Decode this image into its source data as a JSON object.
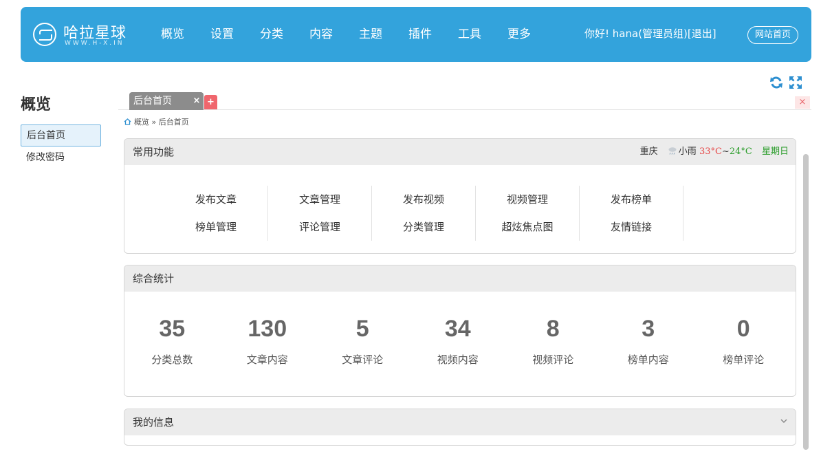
{
  "header": {
    "logo_title": "哈拉星球",
    "logo_sub": "WWW.H-X.IN",
    "nav": [
      "概览",
      "设置",
      "分类",
      "内容",
      "主题",
      "插件",
      "工具",
      "更多"
    ],
    "greeting": "你好!",
    "username": "hana",
    "role": "(管理员组)",
    "logout": "[退出]",
    "site_home": "网站首页",
    "bg_color": "#33a3dc"
  },
  "sidebar": {
    "title": "概览",
    "items": [
      {
        "label": "后台首页",
        "active": true
      },
      {
        "label": "修改密码",
        "active": false
      }
    ]
  },
  "tools": {
    "refresh_icon": "refresh-icon",
    "fullscreen_icon": "fullscreen-icon"
  },
  "tabs": {
    "active_label": "后台首页",
    "close_glyph": "×",
    "add_glyph": "+",
    "close_all_glyph": "×"
  },
  "breadcrumb": {
    "home": "概览",
    "separator": "»",
    "current": "后台首页"
  },
  "common": {
    "title": "常用功能",
    "weather": {
      "city": "重庆",
      "condition": "小雨",
      "high": "33°C",
      "tilde": "~",
      "low": "24°C",
      "day": "星期日"
    },
    "columns": [
      [
        "发布文章",
        "榜单管理"
      ],
      [
        "文章管理",
        "评论管理"
      ],
      [
        "发布视频",
        "分类管理"
      ],
      [
        "视频管理",
        "超炫焦点图"
      ],
      [
        "发布榜单",
        "友情链接"
      ]
    ]
  },
  "stats": {
    "title": "综合统计",
    "items": [
      {
        "value": "35",
        "label": "分类总数"
      },
      {
        "value": "130",
        "label": "文章内容"
      },
      {
        "value": "5",
        "label": "文章评论"
      },
      {
        "value": "34",
        "label": "视频内容"
      },
      {
        "value": "8",
        "label": "视频评论"
      },
      {
        "value": "3",
        "label": "榜单内容"
      },
      {
        "value": "0",
        "label": "榜单评论"
      }
    ]
  },
  "myinfo": {
    "title": "我的信息"
  }
}
